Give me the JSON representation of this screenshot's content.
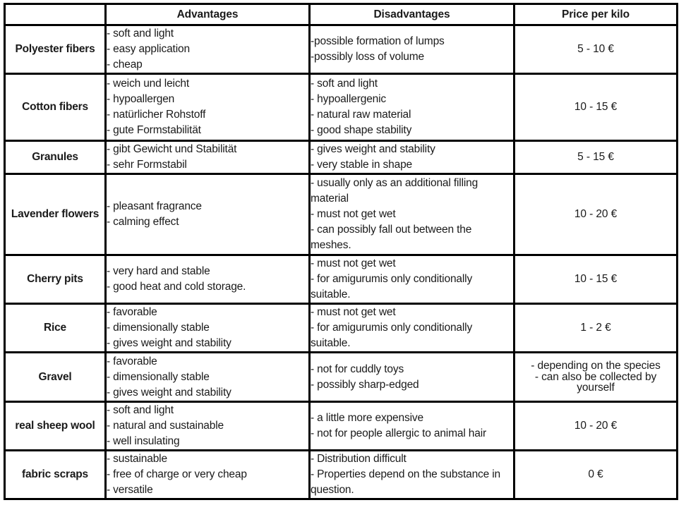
{
  "table": {
    "columns": [
      {
        "key": "material",
        "label": ""
      },
      {
        "key": "advantages",
        "label": "Advantages"
      },
      {
        "key": "disadvantages",
        "label": "Disadvantages"
      },
      {
        "key": "price",
        "label": "Price per kilo"
      }
    ],
    "rows": [
      {
        "material": "Polyester fibers",
        "advantages": [
          "- soft and light",
          "- easy application",
          "- cheap"
        ],
        "disadvantages": [
          "-possible formation of lumps",
          "-possibly loss of volume"
        ],
        "price": [
          "5 - 10 €"
        ]
      },
      {
        "material": "Cotton fibers",
        "advantages": [
          "- weich und leicht",
          "- hypoallergen",
          "- natürlicher Rohstoff",
          "- gute Formstabilität"
        ],
        "disadvantages": [
          "- soft and light",
          "- hypoallergenic",
          "- natural raw material",
          "- good shape stability"
        ],
        "price": [
          "10 - 15 €"
        ]
      },
      {
        "material": "Granules",
        "advantages": [
          "- gibt Gewicht und Stabilität",
          "- sehr Formstabil"
        ],
        "disadvantages": [
          "- gives weight and stability",
          "- very stable in shape"
        ],
        "price": [
          "5 - 15 €"
        ]
      },
      {
        "material": "Lavender flowers",
        "advantages": [
          "- pleasant fragrance",
          "- calming effect"
        ],
        "disadvantages": [
          "- usually only as an additional filling material",
          "- must not get wet",
          "- can possibly fall out between the meshes."
        ],
        "price": [
          "10 - 20 €"
        ]
      },
      {
        "material": "Cherry pits",
        "advantages": [
          "- very hard and stable",
          "- good heat and cold storage."
        ],
        "disadvantages": [
          "- must not get wet",
          "- for amigurumis only conditionally suitable."
        ],
        "price": [
          "10 - 15 €"
        ]
      },
      {
        "material": "Rice",
        "advantages": [
          "- favorable",
          "- dimensionally stable",
          "- gives weight and stability"
        ],
        "disadvantages": [
          "- must not get wet",
          "- for amigurumis only conditionally suitable."
        ],
        "price": [
          "1 - 2 €"
        ]
      },
      {
        "material": "Gravel",
        "advantages": [
          "- favorable",
          "- dimensionally stable",
          "- gives weight and stability"
        ],
        "disadvantages": [
          "- not for cuddly toys",
          "- possibly sharp-edged"
        ],
        "price": [
          "- depending on the species",
          "- can also be collected by yourself"
        ]
      },
      {
        "material": "real sheep wool",
        "advantages": [
          "- soft and light",
          "- natural and sustainable",
          "- well insulating"
        ],
        "disadvantages": [
          "- a little more expensive",
          "- not for people allergic to animal hair"
        ],
        "price": [
          "10 - 20 €"
        ]
      },
      {
        "material": "fabric scraps",
        "advantages": [
          "- sustainable",
          "- free of charge or very cheap",
          "- versatile"
        ],
        "disadvantages": [
          "- Distribution difficult",
          "- Properties depend on the substance in question."
        ],
        "price": [
          "0 €"
        ]
      }
    ]
  },
  "colors": {
    "border": "#000000",
    "text": "#1a1a1a",
    "background": "#ffffff"
  }
}
